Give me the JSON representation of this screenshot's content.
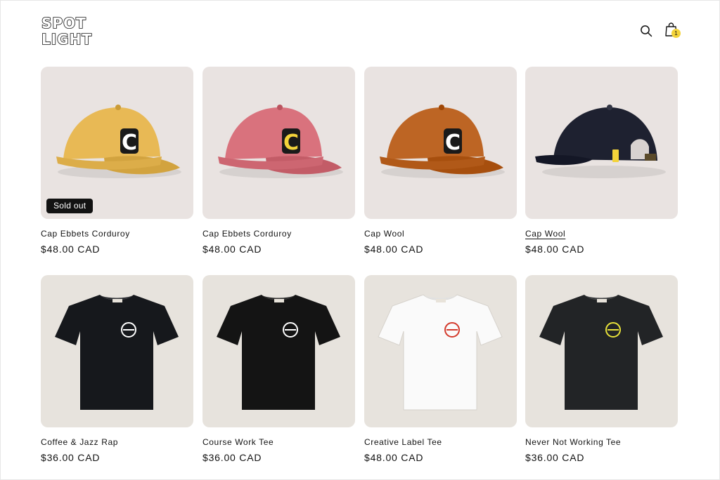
{
  "brand": {
    "line1": "SPOT",
    "line2": "LIGHT"
  },
  "header": {
    "cart_count": "1",
    "search_icon": "search-icon",
    "cart_icon": "shopping-bag-icon"
  },
  "colors": {
    "badge_bg": "#121212",
    "cart_badge": "#f3d33a"
  },
  "products": [
    {
      "title": "Cap Ebbets Corduroy",
      "price": "$48.00 CAD",
      "badge": "Sold out",
      "item": "cap",
      "color": "#e8b955",
      "logo": "#ffffff"
    },
    {
      "title": "Cap Ebbets Corduroy",
      "price": "$48.00 CAD",
      "badge": "",
      "item": "cap",
      "color": "#d9727d",
      "logo": "#f3d33a"
    },
    {
      "title": "Cap Wool",
      "price": "$48.00 CAD",
      "badge": "",
      "item": "cap",
      "color": "#bd6524",
      "logo": "#ffffff"
    },
    {
      "title": "Cap Wool",
      "price": "$48.00 CAD",
      "badge": "",
      "item": "cap-back",
      "color": "#1e2130",
      "logo": "#f3d33a"
    },
    {
      "title": "Coffee & Jazz Rap",
      "price": "$36.00 CAD",
      "badge": "",
      "item": "tee",
      "color": "#16181c",
      "logo": "#ffffff"
    },
    {
      "title": "Course Work Tee",
      "price": "$36.00 CAD",
      "badge": "",
      "item": "tee",
      "color": "#141414",
      "logo": "#ffffff"
    },
    {
      "title": "Creative Label Tee",
      "price": "$48.00 CAD",
      "badge": "",
      "item": "tee",
      "color": "#fafafa",
      "logo": "#d33a2c"
    },
    {
      "title": "Never Not Working Tee",
      "price": "$36.00 CAD",
      "badge": "",
      "item": "tee",
      "color": "#222426",
      "logo": "#e8e23a"
    }
  ]
}
